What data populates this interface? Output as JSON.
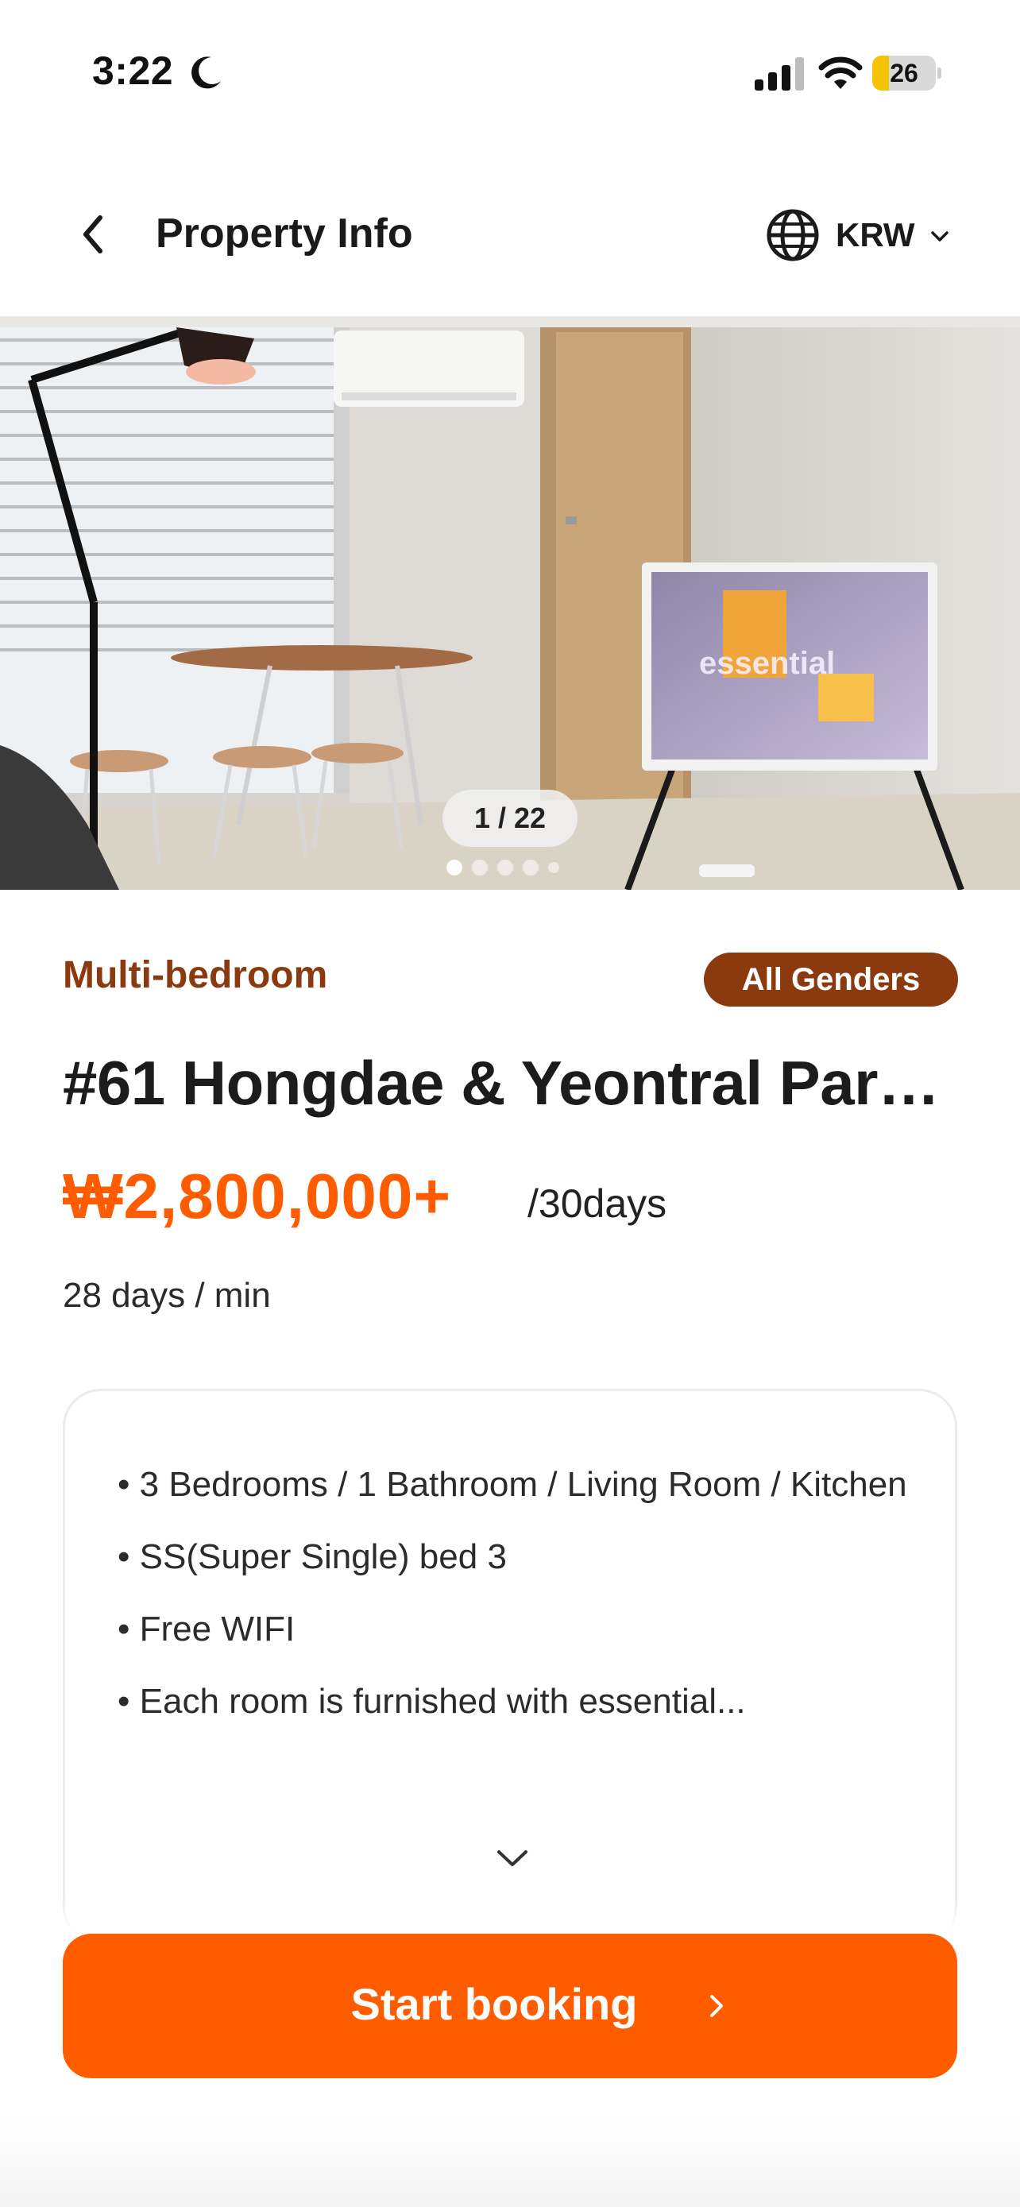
{
  "status_bar": {
    "time": "3:22",
    "battery": "26",
    "battery_level": 0.26
  },
  "header": {
    "title": "Property Info",
    "currency": "KRW"
  },
  "gallery": {
    "counter": "1 / 22",
    "dots_visible": 5,
    "active_dot": 0
  },
  "property": {
    "room_type": "Multi-bedroom",
    "gender": "All Genders",
    "title": "#61 Hongdae & Yeontral Par…",
    "price": "₩2,800,000+",
    "price_unit": "/30days",
    "min_stay": "28 days / min"
  },
  "description": {
    "items": [
      "• 3 Bedrooms / 1 Bathroom / Living Room / Kitchen",
      "• SS(Super Single) bed 3",
      "• Free WIFI",
      "• Each room is furnished with essential..."
    ]
  },
  "booking": {
    "label": "Start booking"
  },
  "colors": {
    "accent": "#ff5c00",
    "badge": "#8b3a10",
    "room_type": "#8b3a10"
  }
}
